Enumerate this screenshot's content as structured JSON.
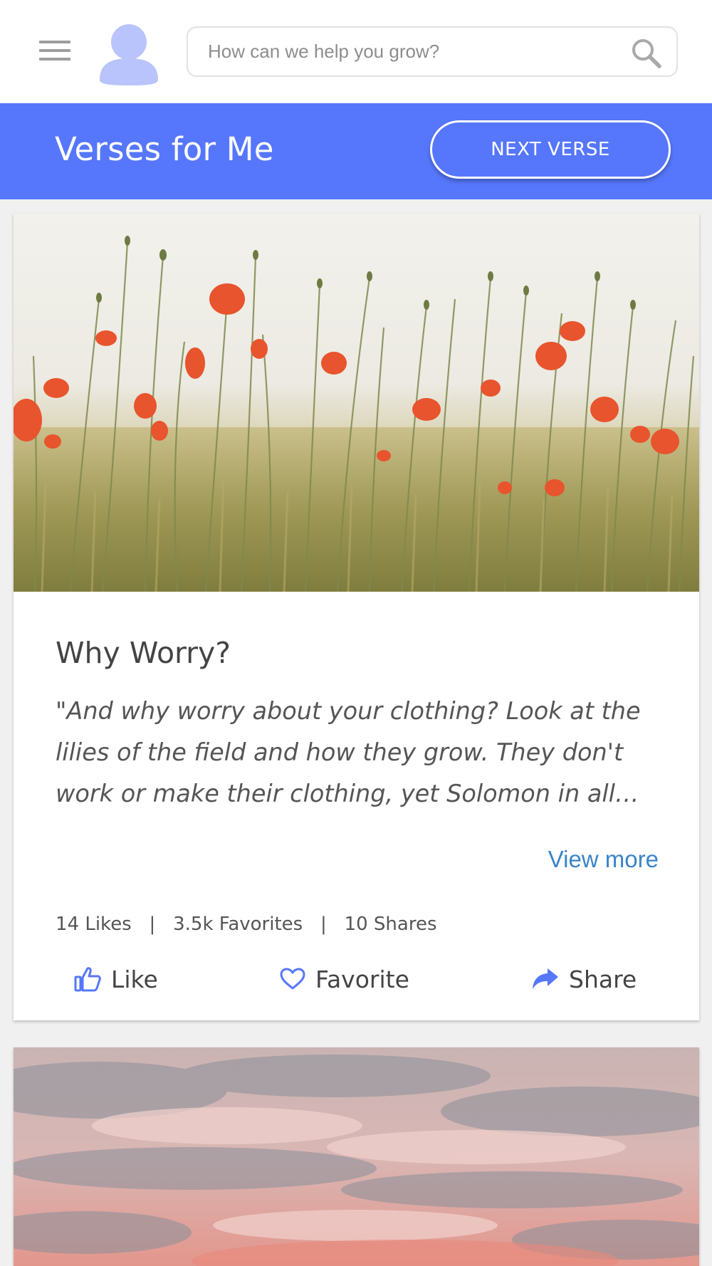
{
  "topbar": {
    "menu_icon": "hamburger-menu-icon",
    "avatar_icon": "user-avatar-icon",
    "search": {
      "placeholder": "How can we help you grow?",
      "value": "",
      "icon": "search-icon"
    }
  },
  "header": {
    "title": "Verses for Me",
    "next_button": "NEXT VERSE",
    "color": "#5677fc"
  },
  "cards": [
    {
      "image": "poppy-field-photo",
      "title": "Why Worry?",
      "body": "\"And why worry about your clothing? Look at the lilies of the field and how they grow. They don't work or make their clothing, yet Solomon in all…",
      "view_more": "View more",
      "stats": {
        "likes": "14 Likes",
        "favorites": "3.5k Favorites",
        "shares": "10 Shares",
        "separator": "|"
      },
      "actions": [
        {
          "label": "Like",
          "icon": "thumbs-up-icon"
        },
        {
          "label": "Favorite",
          "icon": "heart-icon"
        },
        {
          "label": "Share",
          "icon": "share-arrow-icon"
        }
      ]
    },
    {
      "image": "pink-cloudy-sky-photo"
    }
  ],
  "colors": {
    "accent": "#5677fc",
    "link": "#3a84c8",
    "avatar": "#b8c4fb"
  }
}
